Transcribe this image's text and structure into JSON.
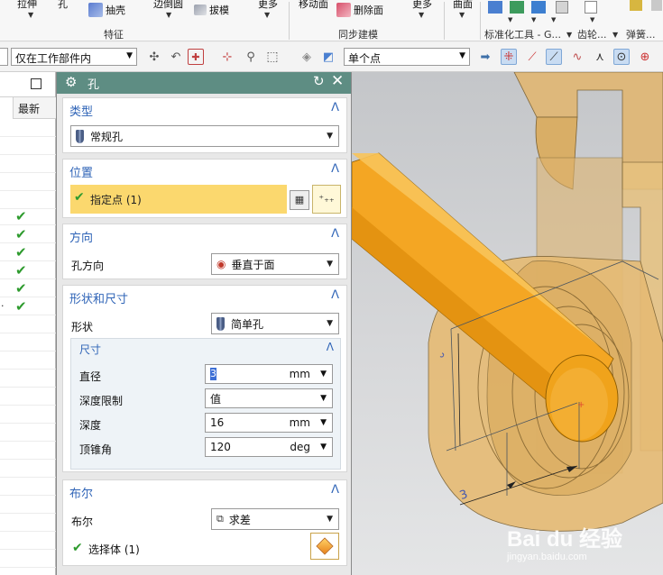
{
  "ribbon": {
    "items": [
      {
        "label": "拉伸",
        "icon": "extrude-icon"
      },
      {
        "label": "孔",
        "icon": "hole-icon"
      },
      {
        "label": "抽壳",
        "icon": "shell-icon"
      },
      {
        "label": "边倒圆",
        "icon": "edge-blend-icon"
      },
      {
        "label": "拔模",
        "icon": "draft-icon"
      },
      {
        "label": "更多",
        "icon": "more-icon"
      },
      {
        "label": "移动面",
        "icon": "move-face-icon"
      },
      {
        "label": "删除面",
        "icon": "delete-face-icon"
      },
      {
        "label": "更多",
        "icon": "more-icon"
      },
      {
        "label": "曲面",
        "icon": "surface-icon"
      }
    ],
    "groups": [
      "特征",
      "同步建模",
      "标准化工具 - G...",
      "齿轮...",
      "弹簧..."
    ]
  },
  "toolbar": {
    "scope_filter": "仅在工作部件内",
    "point_filter": "单个点"
  },
  "navigator": {
    "column_header": "最新",
    "checked_rows": 6
  },
  "dialog": {
    "title": "孔",
    "type_section": {
      "title": "类型",
      "value": "常规孔"
    },
    "position_section": {
      "title": "位置",
      "point_label": "指定点 (1)"
    },
    "direction_section": {
      "title": "方向",
      "label": "孔方向",
      "value": "垂直于面"
    },
    "shape_section": {
      "title": "形状和尺寸",
      "shape_label": "形状",
      "shape_value": "简单孔",
      "dims": {
        "title": "尺寸",
        "diameter_label": "直径",
        "diameter_value": "3",
        "diameter_unit": "mm",
        "depth_limit_label": "深度限制",
        "depth_limit_value": "值",
        "depth_label": "深度",
        "depth_value": "16",
        "depth_unit": "mm",
        "tip_angle_label": "顶锥角",
        "tip_angle_value": "120",
        "tip_angle_unit": "deg"
      }
    },
    "boolean_section": {
      "title": "布尔",
      "label": "布尔",
      "value": "求差",
      "body_label": "选择体 (1)"
    }
  },
  "viewport": {
    "dimension_label": "3",
    "watermark": "Bai du 经验",
    "watermark_url": "jingyan.baidu.com"
  },
  "colors": {
    "dialog_title_bg": "#5e8d83",
    "section_title": "#2f64b7",
    "highlight_row": "#fbd86e",
    "check_green": "#2e9b2e",
    "cylinder_orange": "#f4a623"
  }
}
